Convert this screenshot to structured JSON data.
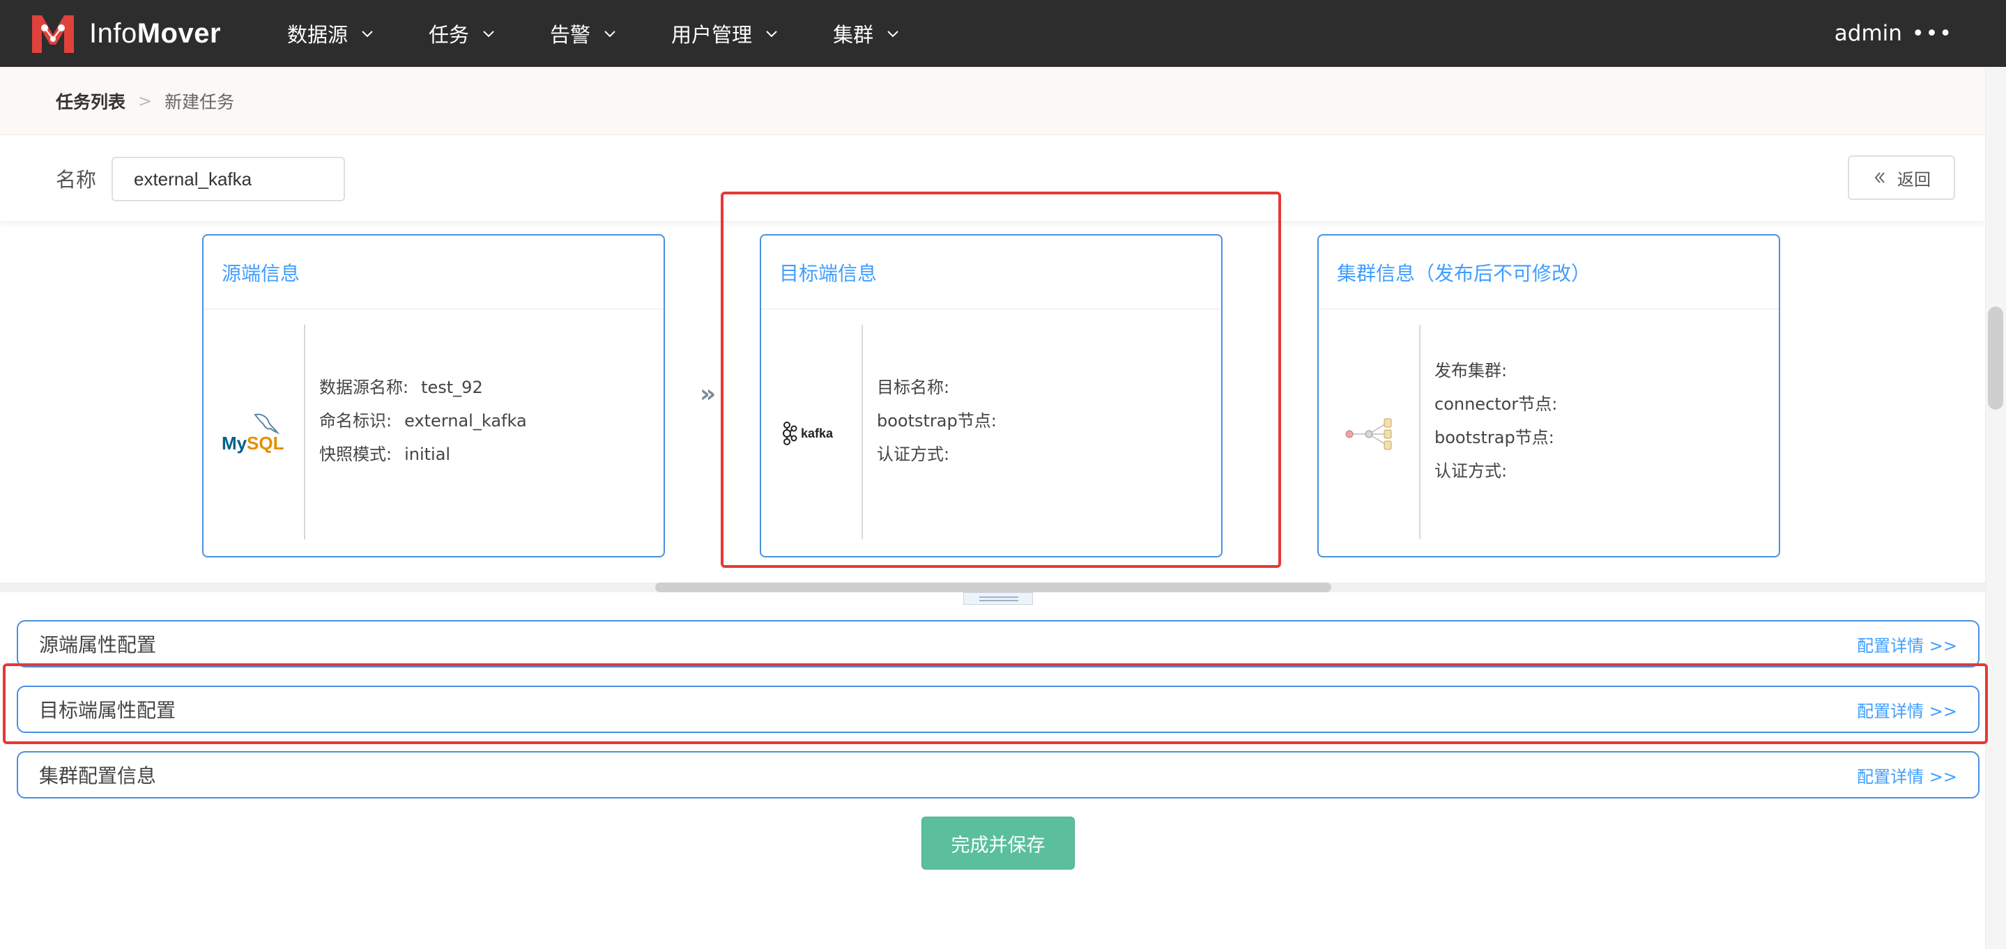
{
  "app": {
    "logo_light": "Info",
    "logo_bold": "Mover",
    "nav": [
      {
        "label": "数据源"
      },
      {
        "label": "任务"
      },
      {
        "label": "告警"
      },
      {
        "label": "用户管理"
      },
      {
        "label": "集群"
      }
    ],
    "user": "admin",
    "user_more": "•••"
  },
  "breadcrumb": {
    "first": "任务列表",
    "separator": ">",
    "current": "新建任务"
  },
  "name_row": {
    "label": "名称",
    "value": "external_kafka",
    "back_label": "返回"
  },
  "cards": {
    "source": {
      "title": "源端信息",
      "logo": "MySQL",
      "rows": [
        {
          "key": "数据源名称:",
          "value": "test_92"
        },
        {
          "key": "命名标识:",
          "value": "external_kafka"
        },
        {
          "key": "快照模式:",
          "value": "initial"
        }
      ]
    },
    "arrow": "»",
    "target": {
      "title": "目标端信息",
      "logo": "kafka",
      "rows": [
        {
          "key": "目标名称:",
          "value": ""
        },
        {
          "key": "bootstrap节点:",
          "value": ""
        },
        {
          "key": "认证方式:",
          "value": ""
        }
      ]
    },
    "cluster": {
      "title": "集群信息（发布后不可修改）",
      "rows": [
        {
          "key": "发布集群:",
          "value": ""
        },
        {
          "key": "connector节点:",
          "value": ""
        },
        {
          "key": "bootstrap节点:",
          "value": ""
        },
        {
          "key": "认证方式:",
          "value": ""
        }
      ]
    }
  },
  "sections": [
    {
      "title": "源端属性配置",
      "link": "配置详情 >>"
    },
    {
      "title": "目标端属性配置",
      "link": "配置详情 >>"
    },
    {
      "title": "集群配置信息",
      "link": "配置详情 >>"
    }
  ],
  "save_label": "完成并保存",
  "colors": {
    "navbar": "#2d2d2d",
    "accent": "#409eff",
    "card_border": "#4a90e2",
    "highlight": "#e53935",
    "save_button": "#5bbf9d",
    "logo_red": "#e0413c"
  }
}
